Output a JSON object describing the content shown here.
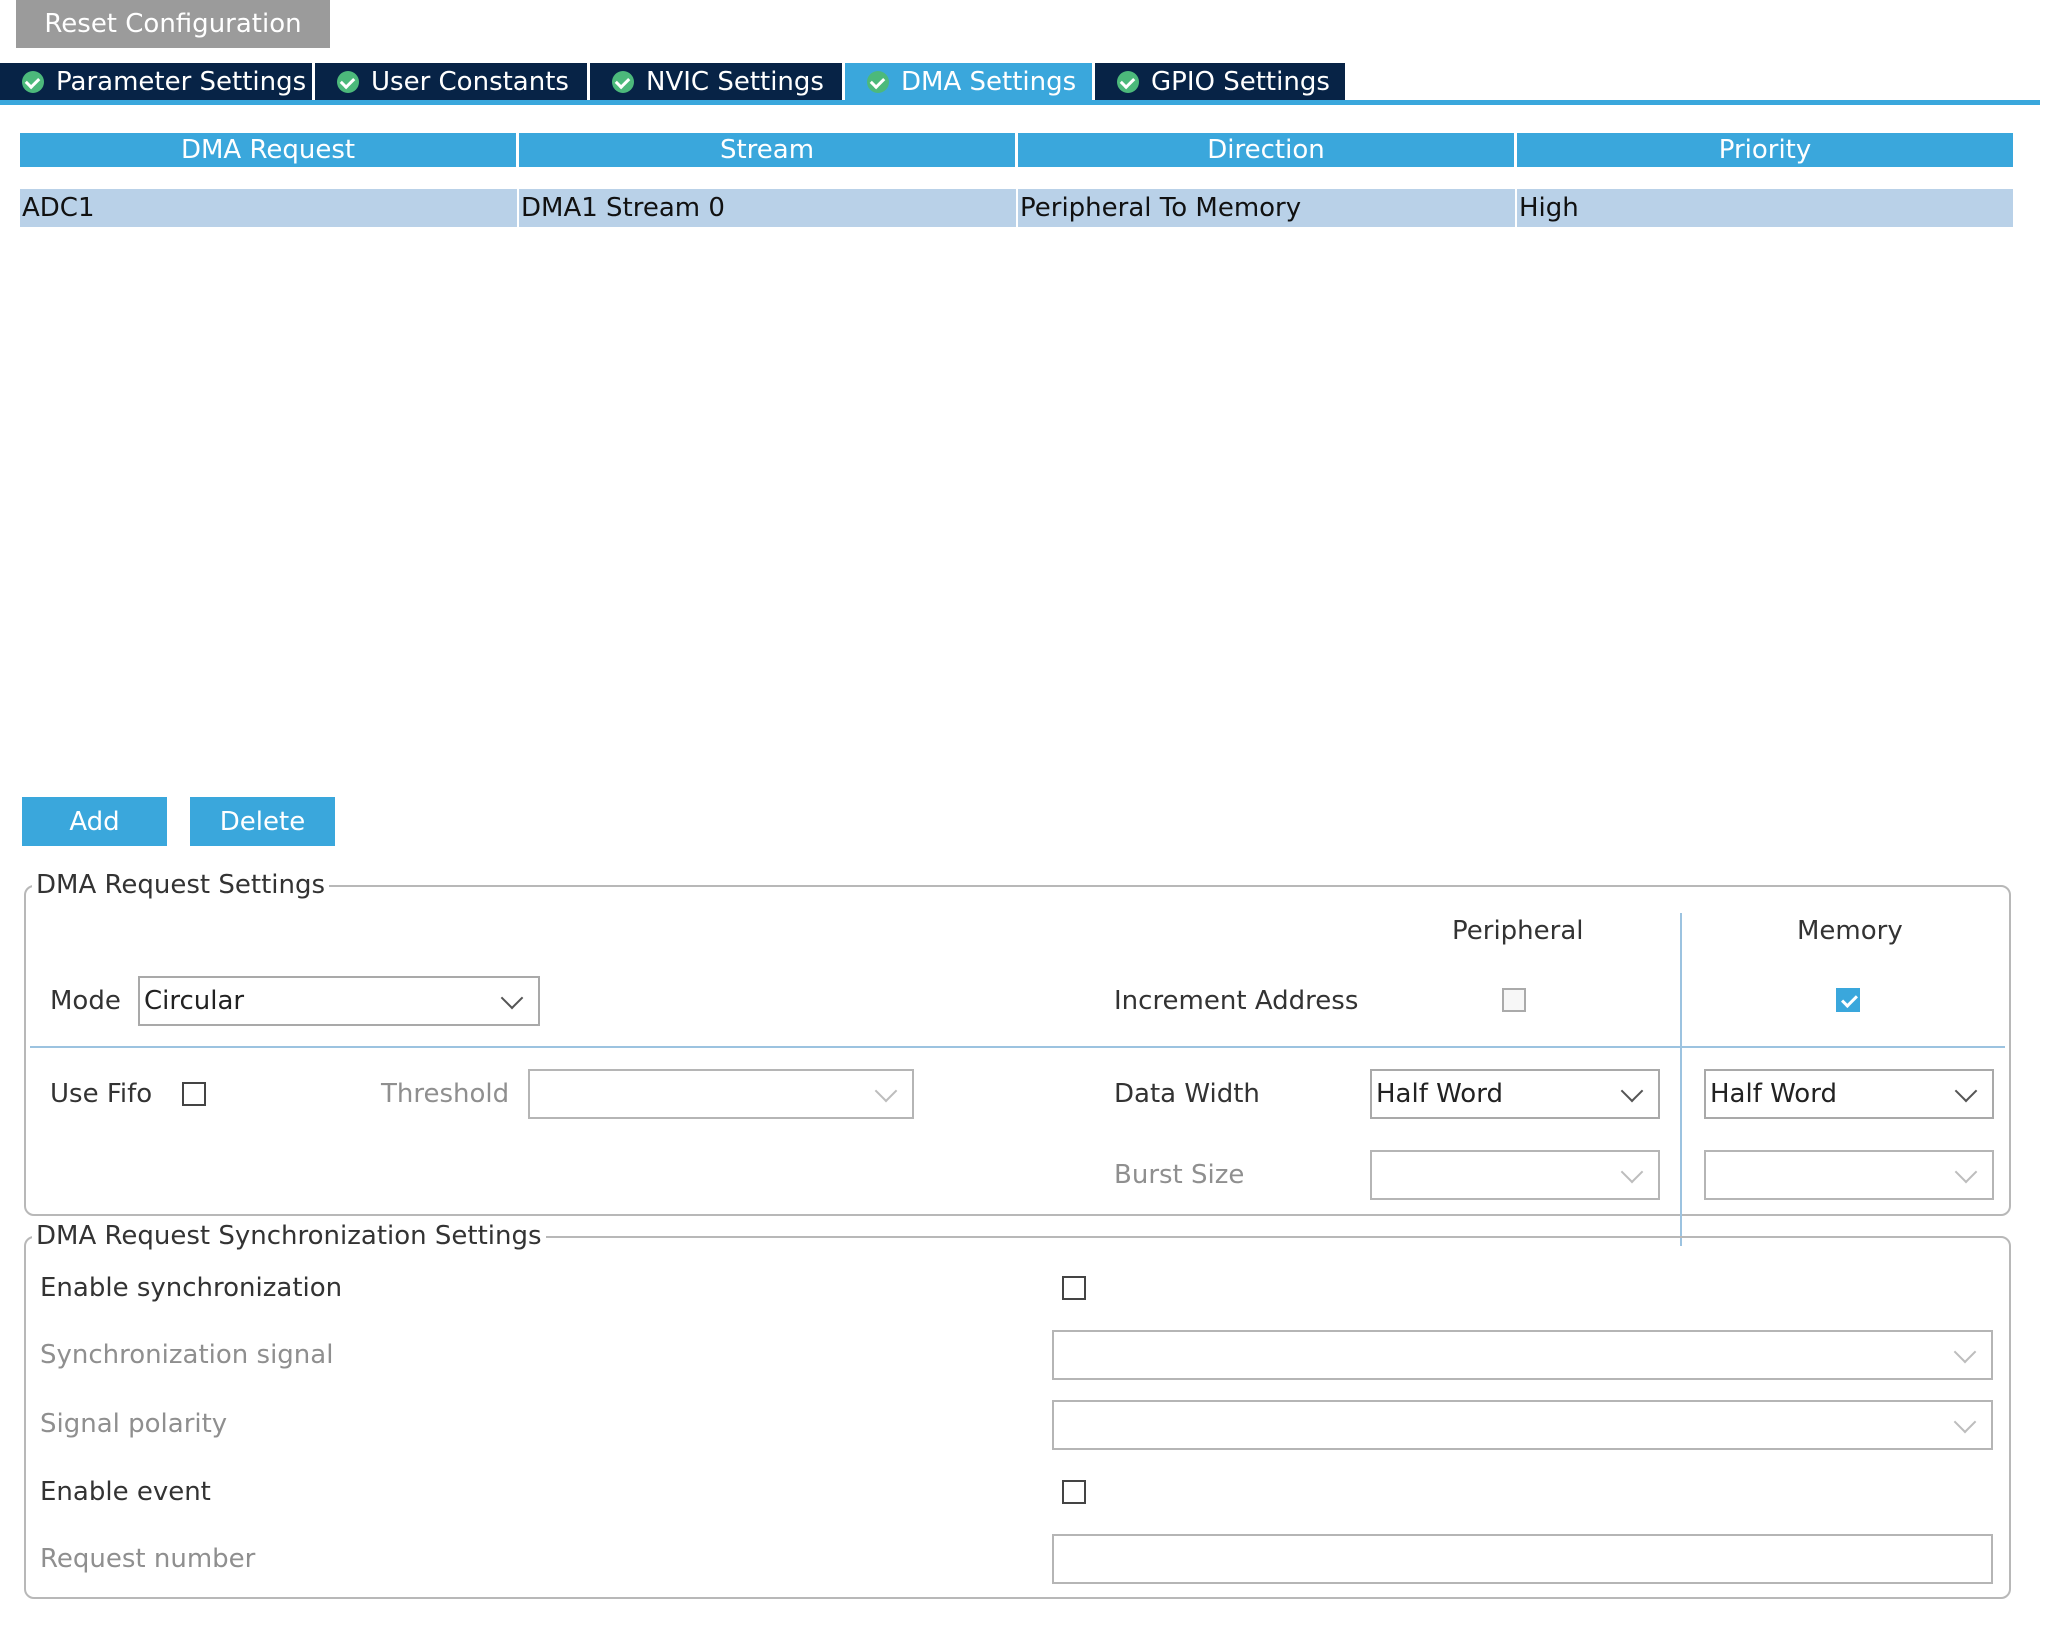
{
  "toolbar": {
    "reset_label": "Reset Configuration"
  },
  "tabs": [
    {
      "label": "Parameter Settings",
      "active": false
    },
    {
      "label": "User Constants",
      "active": false
    },
    {
      "label": "NVIC Settings",
      "active": false
    },
    {
      "label": "DMA Settings",
      "active": true
    },
    {
      "label": "GPIO Settings",
      "active": false
    }
  ],
  "table": {
    "columns": [
      "DMA Request",
      "Stream",
      "Direction",
      "Priority"
    ],
    "rows": [
      {
        "request": "ADC1",
        "stream": "DMA1 Stream 0",
        "direction": "Peripheral To Memory",
        "priority": "High"
      }
    ]
  },
  "actions": {
    "add_label": "Add",
    "delete_label": "Delete"
  },
  "request_settings": {
    "title": "DMA Request Settings",
    "mode_label": "Mode",
    "mode_value": "Circular",
    "peripheral_header": "Peripheral",
    "memory_header": "Memory",
    "increment_label": "Increment Address",
    "peripheral_increment": false,
    "memory_increment": true,
    "use_fifo_label": "Use Fifo",
    "use_fifo": false,
    "threshold_label": "Threshold",
    "threshold_value": "",
    "data_width_label": "Data Width",
    "peripheral_data_width": "Half Word",
    "memory_data_width": "Half Word",
    "burst_size_label": "Burst Size",
    "peripheral_burst": "",
    "memory_burst": ""
  },
  "sync_settings": {
    "title": "DMA Request Synchronization Settings",
    "enable_sync_label": "Enable synchronization",
    "enable_sync": false,
    "sync_signal_label": "Synchronization signal",
    "sync_signal_value": "",
    "signal_polarity_label": "Signal polarity",
    "signal_polarity_value": "",
    "enable_event_label": "Enable event",
    "enable_event": false,
    "request_number_label": "Request number",
    "request_number_value": ""
  },
  "colors": {
    "accent": "#3aa7dc",
    "tab_dark": "#072346",
    "row_selected": "#b9d1e8",
    "check_green": "#4cb97b",
    "reset_gray": "#9b9b9b"
  }
}
